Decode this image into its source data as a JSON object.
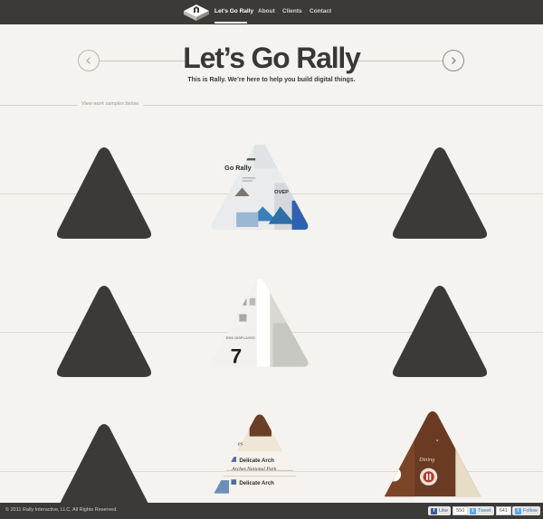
{
  "nav": {
    "logo_icon": "rally-logo-icon",
    "items": [
      {
        "label": "Let’s Go Rally",
        "active": true
      },
      {
        "label": "About",
        "active": false
      },
      {
        "label": "Clients",
        "active": false
      },
      {
        "label": "Contact",
        "active": false
      }
    ]
  },
  "hero": {
    "title": "Let’s Go Rally",
    "subtitle": "This is Rally. We’re here to help you build digital things.",
    "prev_icon": "chevron-left-icon",
    "next_icon": "chevron-right-icon"
  },
  "samples": {
    "label": "View work samples below."
  },
  "thumbnails": {
    "t1": {
      "heading": "Go Rally",
      "tag": "OVEP"
    },
    "t2": {
      "caption": "ENS DISPLAYED",
      "number": "7"
    },
    "t3": {
      "partial": "es",
      "items": [
        "Delicate Arch",
        "Delicate Arch"
      ],
      "subtitle": "Arches National Park"
    },
    "t4": {
      "label": "Dining"
    }
  },
  "footer": {
    "copyright": "© 2011 Rally Interactive, LLC. All Rights Reserved.",
    "like_label": "Like",
    "like_count": "550",
    "tweet_label": "Tweet",
    "tweet_count": "641",
    "follow_label": "Follow"
  },
  "colors": {
    "background": "#f5f3ef",
    "dark": "#3c3a38",
    "triangle": "#3c3a38"
  }
}
